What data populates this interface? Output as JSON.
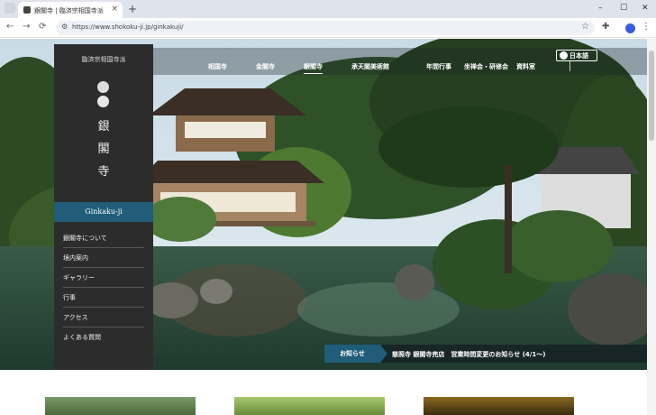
{
  "browser": {
    "tab_title": "銀閣寺 | 臨済宗相国寺派",
    "tab_close": "×",
    "new_tab": "+",
    "url": "https://www.shokoku-ji.jp/ginkakuji/",
    "back": "←",
    "forward": "→",
    "reload": "⟳",
    "bookmark": "☆",
    "menu": "⋮",
    "minimize": "–",
    "maximize": "☐",
    "close": "✕"
  },
  "site": {
    "sect_name": "臨済宗相国寺派",
    "temple_chars": [
      "銀",
      "閣",
      "寺"
    ],
    "romaji": "Ginkaku-ji",
    "nav": [
      {
        "label": "相国寺",
        "active": false
      },
      {
        "label": "金閣寺",
        "active": false
      },
      {
        "label": "銀閣寺",
        "active": true
      },
      {
        "label": "承天閣美術館",
        "active": false
      },
      {
        "label": "年間行事",
        "active": false
      },
      {
        "label": "坐禅会・研修会",
        "active": false
      },
      {
        "label": "資料室",
        "active": false
      }
    ],
    "language": "日本語",
    "menu": [
      "銀閣寺について",
      "境内案内",
      "ギャラリー",
      "行事",
      "アクセス",
      "よくある質問"
    ],
    "news_label": "お知らせ",
    "news_text": "慈照寺 銀閣寺売店　営業時間変更のお知らせ (4/1〜)"
  }
}
